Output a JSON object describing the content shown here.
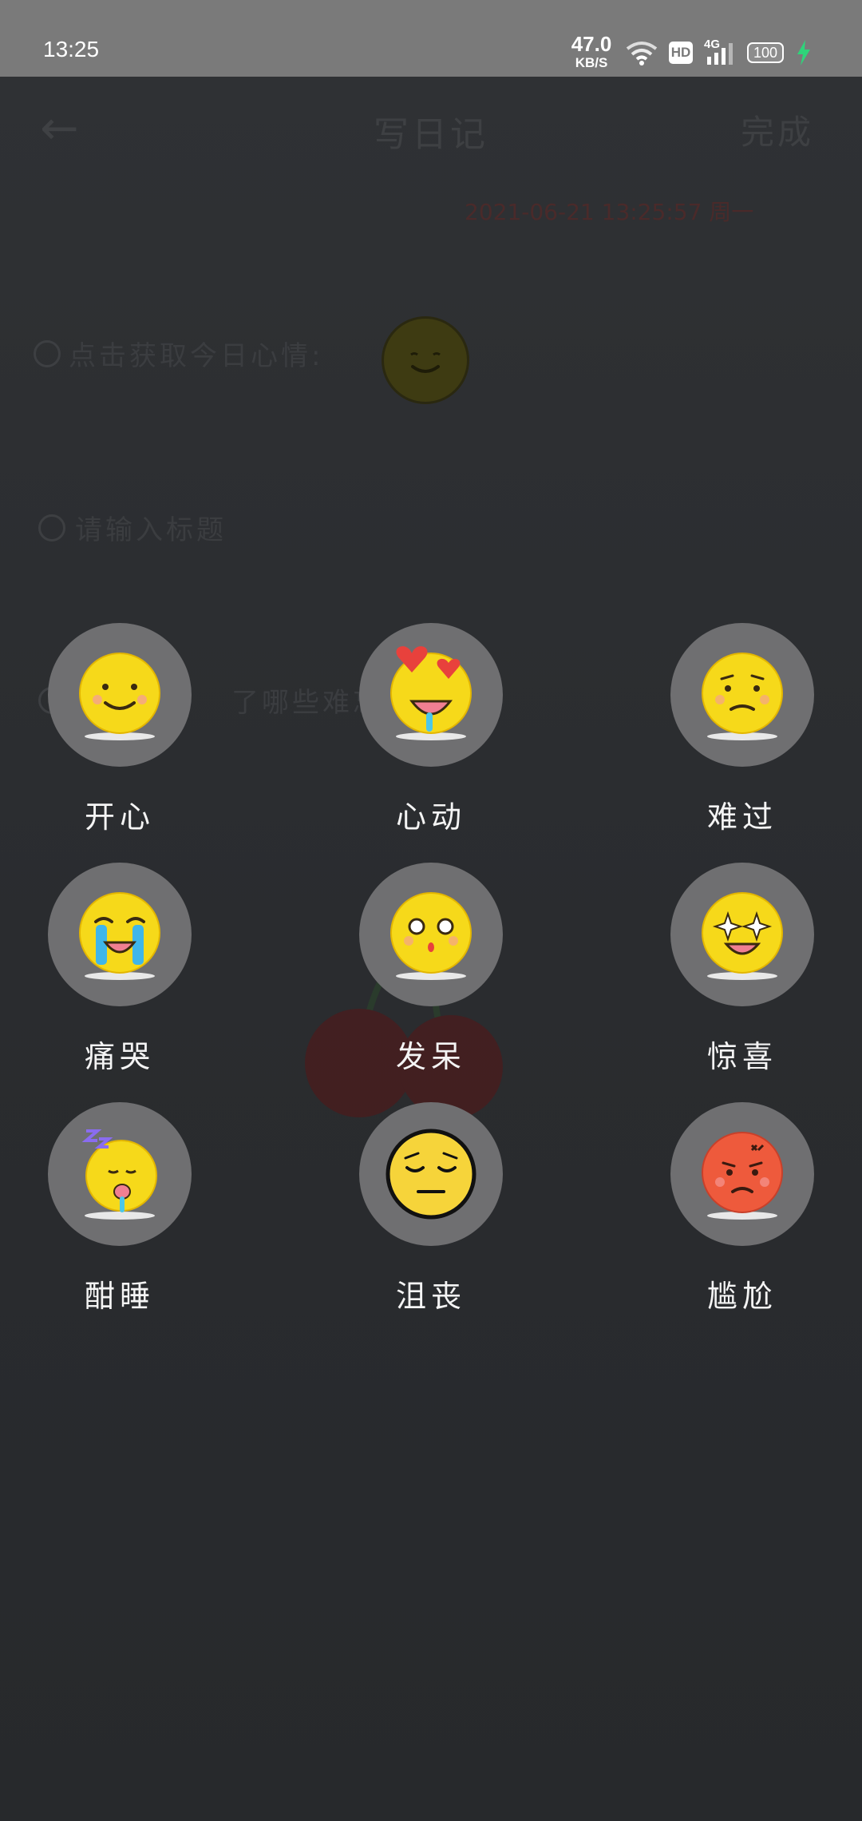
{
  "status_bar": {
    "time": "13:25",
    "speed_value": "47.0",
    "speed_unit": "KB/S",
    "hd": "HD",
    "network": "4G",
    "battery": "100"
  },
  "editor": {
    "title": "写日记",
    "done_label": "完成",
    "date": "2021-06-21  13:25:57  周一",
    "mood_prompt": "点击获取今日心情:",
    "title_placeholder": "请输入标题",
    "content_placeholder": "了哪些难忘的"
  },
  "moods": [
    {
      "label": "开心",
      "icon": "happy-face-icon"
    },
    {
      "label": "心动",
      "icon": "heart-eyes-icon"
    },
    {
      "label": "难过",
      "icon": "sad-face-icon"
    },
    {
      "label": "痛哭",
      "icon": "crying-face-icon"
    },
    {
      "label": "发呆",
      "icon": "blank-face-icon"
    },
    {
      "label": "惊喜",
      "icon": "star-eyes-icon"
    },
    {
      "label": "酣睡",
      "icon": "sleeping-face-icon"
    },
    {
      "label": "沮丧",
      "icon": "dejected-face-icon"
    },
    {
      "label": "尴尬",
      "icon": "angry-face-icon"
    }
  ],
  "colors": {
    "status_bar": "#7a7a7a",
    "overlay_background": "#2b2d30",
    "circle": "#6f6f71",
    "emoji_yellow": "#f6d91a",
    "angry_red": "#ee5a3c",
    "charging_green": "#2ed47a"
  }
}
